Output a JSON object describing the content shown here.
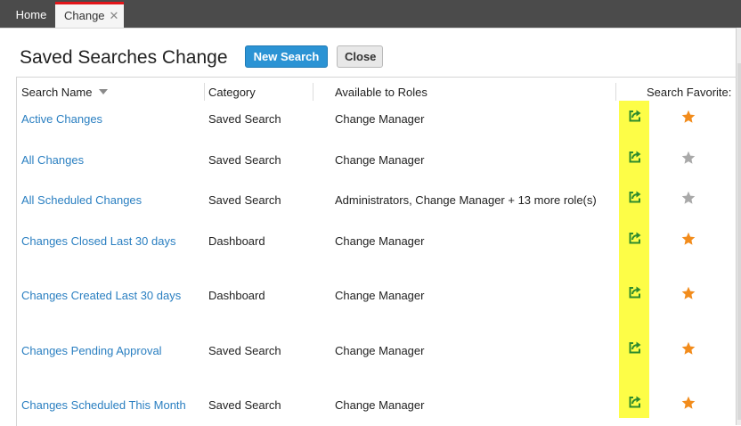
{
  "tabs": {
    "home_label": "Home",
    "change_label": "Change",
    "close_glyph": "✕"
  },
  "header": {
    "title": "Saved Searches  Change",
    "new_search_label": "New Search",
    "close_label": "Close"
  },
  "table": {
    "columns": {
      "name": "Search Name",
      "category": "Category",
      "roles": "Available to Roles",
      "favorite": "Search Favorite:"
    },
    "rows": [
      {
        "name": "Active Changes",
        "category": "Saved Search",
        "roles": "Change Manager",
        "favorite": true
      },
      {
        "name": "All Changes",
        "category": "Saved Search",
        "roles": "Change Manager",
        "favorite": false
      },
      {
        "name": "All Scheduled Changes",
        "category": "Saved Search",
        "roles": "Administrators, Change Manager + 13 more role(s)",
        "favorite": false
      },
      {
        "name": "Changes Closed Last 30 days",
        "category": "Dashboard",
        "roles": "Change Manager",
        "favorite": true
      },
      {
        "name": "Changes Created Last 30 days",
        "category": "Dashboard",
        "roles": "Change Manager",
        "favorite": true
      },
      {
        "name": "Changes Pending Approval",
        "category": "Saved Search",
        "roles": "Change Manager",
        "favorite": true
      },
      {
        "name": "Changes Scheduled This Month",
        "category": "Saved Search",
        "roles": "Change Manager",
        "favorite": true
      }
    ]
  },
  "icons": {
    "share": "share-icon",
    "favorite": "star-icon",
    "sort": "sort-desc-icon"
  },
  "colors": {
    "link": "#2a7fc1",
    "primary_button": "#2b93d4",
    "active_tab_accent": "#e3161a",
    "highlight": "#fdfd47",
    "share_icon": "#2e8b2e",
    "star_on": "#f28c1c",
    "star_off": "#a9a9a9"
  }
}
